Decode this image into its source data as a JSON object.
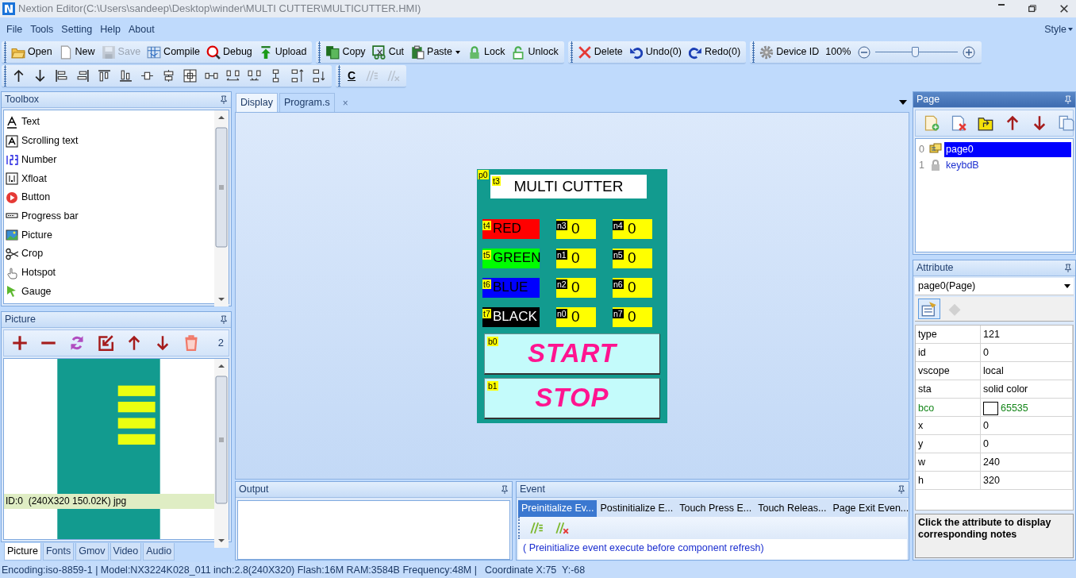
{
  "window": {
    "title": "Nextion Editor(C:\\Users\\sandeep\\Desktop\\winder\\MULTI CUTTER\\MULTICUTTER.HMI)"
  },
  "menu": [
    "File",
    "Tools",
    "Setting",
    "Help",
    "About"
  ],
  "style_menu": "Style",
  "toolbar": {
    "groups": [
      {
        "items": [
          {
            "label": "Open",
            "disabled": false,
            "dropdown": false
          },
          {
            "label": "New",
            "disabled": false,
            "dropdown": false
          },
          {
            "label": "Save",
            "disabled": true,
            "dropdown": false
          },
          {
            "label": "Compile",
            "disabled": false,
            "dropdown": false
          },
          {
            "label": "Debug",
            "disabled": false,
            "dropdown": false
          },
          {
            "label": "Upload",
            "disabled": false,
            "dropdown": false
          }
        ]
      },
      {
        "items": [
          {
            "label": "Copy",
            "disabled": false,
            "dropdown": false
          },
          {
            "label": "Cut",
            "disabled": false,
            "dropdown": false
          },
          {
            "label": "Paste",
            "disabled": false,
            "dropdown": true
          },
          {
            "label": "Lock",
            "disabled": false,
            "dropdown": false
          },
          {
            "label": "Unlock",
            "disabled": false,
            "dropdown": false
          }
        ]
      },
      {
        "items": [
          {
            "label": "Delete",
            "disabled": false,
            "dropdown": false
          },
          {
            "label": "Undo(0)",
            "disabled": false,
            "dropdown": false
          },
          {
            "label": "Redo(0)",
            "disabled": false,
            "dropdown": false
          }
        ]
      },
      {
        "items": [
          {
            "label": "Device ID",
            "disabled": false,
            "dropdown": false
          }
        ]
      }
    ],
    "zoom": {
      "reading": "100%",
      "level": 0.48
    }
  },
  "layout_tools": [
    {
      "disabled": false
    },
    {
      "disabled": false
    },
    {
      "disabled": false
    },
    {
      "disabled": false
    },
    {
      "disabled": false
    },
    {
      "disabled": false
    },
    {
      "disabled": false
    },
    {
      "disabled": false
    },
    {
      "disabled": false
    },
    {
      "disabled": false
    },
    {
      "disabled": false
    },
    {
      "disabled": false
    },
    {
      "disabled": false
    },
    {
      "disabled": false
    },
    {
      "disabled": false
    }
  ],
  "comment_tools": [
    {
      "label": "C",
      "disabled": false
    },
    {
      "disabled": true
    },
    {
      "disabled": true
    }
  ],
  "toolbox": {
    "title": "Toolbox",
    "active": false,
    "items": [
      "Text",
      "Scrolling text",
      "Number",
      "Xfloat",
      "Button",
      "Progress bar",
      "Picture",
      "Crop",
      "Hotspot",
      "Gauge"
    ]
  },
  "picture_panel": {
    "title": "Picture",
    "active": false,
    "count": "2",
    "images": [
      {
        "caption": "ID:0  (240X320 150.02K) jpg",
        "selected": true
      }
    ]
  },
  "left_tabs": [
    {
      "label": "Picture",
      "selected": true
    },
    {
      "label": "Fonts",
      "selected": false
    },
    {
      "label": "Gmov",
      "selected": false
    },
    {
      "label": "Video",
      "selected": false
    },
    {
      "label": "Audio",
      "selected": false
    }
  ],
  "document_tabs": [
    {
      "label": "Display",
      "selected": true
    },
    {
      "label": "Program.s",
      "selected": false,
      "close": "×"
    }
  ],
  "hmi_page": {
    "tag": "p0",
    "title": {
      "tag": "t3",
      "text": "MULTI CUTTER"
    },
    "rows": [
      {
        "label": {
          "tag": "t4",
          "text": "RED",
          "color": "#ff0000"
        },
        "values": [
          {
            "tag": "n3",
            "text": "0"
          },
          {
            "tag": "n4",
            "text": "0"
          }
        ]
      },
      {
        "label": {
          "tag": "t5",
          "text": "GREEN",
          "color": "#00ff00"
        },
        "values": [
          {
            "tag": "n1",
            "text": "0"
          },
          {
            "tag": "n5",
            "text": "0"
          }
        ]
      },
      {
        "label": {
          "tag": "t6",
          "text": "BLUE",
          "color": "#0000ff"
        },
        "values": [
          {
            "tag": "n2",
            "text": "0"
          },
          {
            "tag": "n6",
            "text": "0"
          }
        ]
      },
      {
        "label": {
          "tag": "t7",
          "text": "BLACK",
          "color": "#000000"
        },
        "values": [
          {
            "tag": "n0",
            "text": "0"
          },
          {
            "tag": "n7",
            "text": "0"
          }
        ]
      }
    ],
    "buttons": [
      {
        "tag": "b0",
        "text": "START"
      },
      {
        "tag": "b1",
        "text": "STOP"
      }
    ]
  },
  "output": {
    "title": "Output",
    "active": false
  },
  "event": {
    "title": "Event",
    "active": false,
    "tabs": [
      {
        "label": "Preinitialize Ev...",
        "selected": true
      },
      {
        "label": "Postinitialize E...",
        "selected": false
      },
      {
        "label": "Touch Press E...",
        "selected": false
      },
      {
        "label": "Touch Releas...",
        "selected": false
      },
      {
        "label": "Page Exit Even...",
        "selected": false
      }
    ],
    "tools": [
      {
        "disabled": false
      },
      {
        "disabled": false
      }
    ],
    "text": "( Preinitialize event execute before component refresh)"
  },
  "page_panel": {
    "title": "Page",
    "active": true
  },
  "pages": [
    {
      "index": "0",
      "name": "page0",
      "selected": true,
      "locked": false
    },
    {
      "index": "1",
      "name": "keybdB",
      "selected": false,
      "locked": true
    }
  ],
  "attribute": {
    "title": "Attribute",
    "active": false,
    "object": "page0(Page)",
    "tools": [
      {
        "selected": true,
        "disabled": false
      },
      {
        "selected": false,
        "disabled": true
      }
    ],
    "rows": [
      {
        "name": "type",
        "value": "121",
        "changed": false
      },
      {
        "name": "id",
        "value": "0",
        "changed": false
      },
      {
        "name": "vscope",
        "value": "local",
        "changed": false
      },
      {
        "name": "sta",
        "value": "solid color",
        "changed": false
      },
      {
        "name": "bco",
        "value": "65535",
        "changed": true,
        "color": "#ffffff"
      },
      {
        "name": "x",
        "value": "0",
        "changed": false
      },
      {
        "name": "y",
        "value": "0",
        "changed": false
      },
      {
        "name": "w",
        "value": "240",
        "changed": false
      },
      {
        "name": "h",
        "value": "320",
        "changed": false
      }
    ],
    "note": "Click the attribute to display corresponding notes"
  },
  "status_bar": {
    "info": "Encoding:iso-8859-1 | Model:NX3224K028_011 inch:2.8(240X320) Flash:16M RAM:3584B Frequency:48M |",
    "coordinate": "Coordinate X:75  Y:-68"
  }
}
